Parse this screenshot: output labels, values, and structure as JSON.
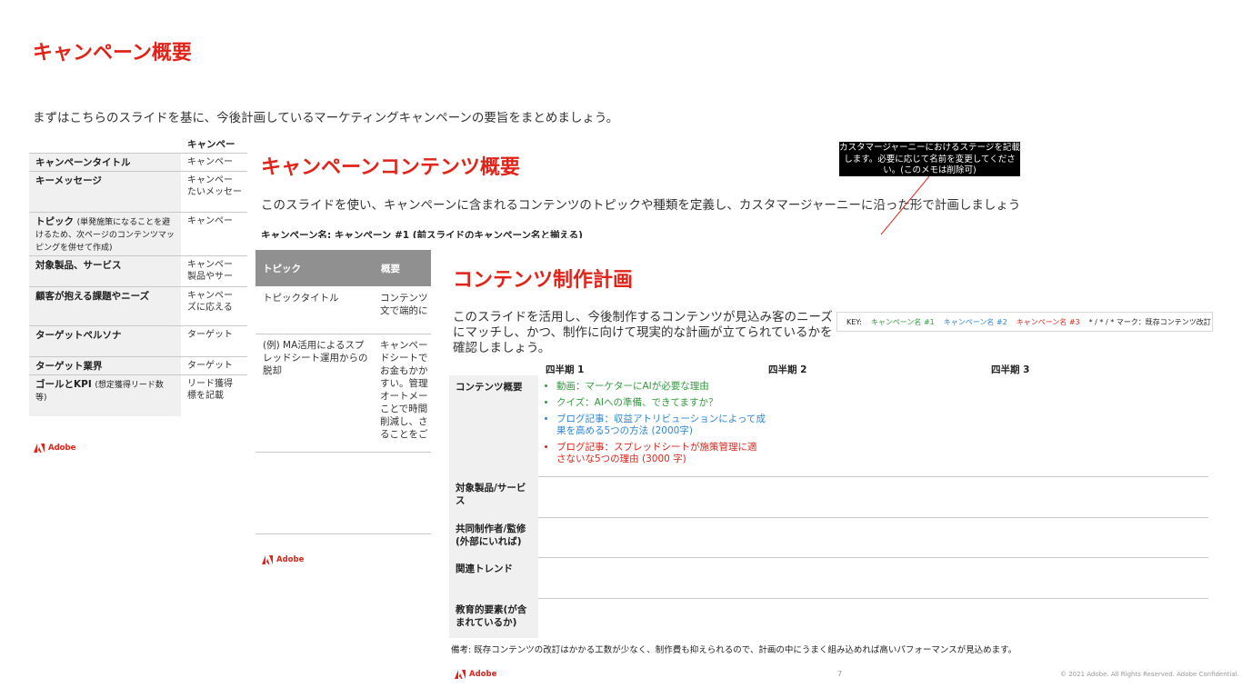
{
  "slide1": {
    "title": "キャンペーン概要",
    "intro": "まずはこちらのスライドを基に、今後計画しているマーケティングキャンペーンの要旨をまとめましょう。",
    "column_header": "キャンペー",
    "rows": [
      {
        "label": "キャンペーンタイトル",
        "note": "",
        "value": "キャンペー"
      },
      {
        "label": "キーメッセージ",
        "note": "",
        "value": "キャンペー\nたいメッセー"
      },
      {
        "label": "トピック",
        "note": "(単発施策になることを避けるため、次ページのコンテンツマッピングを併せて作成)",
        "value": "キャンペー"
      },
      {
        "label": "対象製品、サービス",
        "note": "",
        "value": "キャンペー\n製品やサー"
      },
      {
        "label": "顧客が抱える課題やニーズ",
        "note": "",
        "value": "キャンペー\nズに応える"
      },
      {
        "label": "ターゲットペルソナ",
        "note": "",
        "value": "ターゲット"
      },
      {
        "label": "ターゲット業界",
        "note": "",
        "value": "ターゲット"
      },
      {
        "label": "ゴールとKPI",
        "note": "(想定獲得リード数等)",
        "value": "リード獲得\n標を記載"
      }
    ],
    "logo": "Adobe"
  },
  "slide2": {
    "title": "キャンペーンコンテンツ概要",
    "intro": "このスライドを使い、キャンペーンに含まれるコンテンツのトピックや種類を定義し、カスタマージャーニーに沿った形で計画しましょう",
    "campaign_name": "キャンペーン名: キャンペーン #1 (前スライドのキャンペーン名と揃える)",
    "headers": [
      "トピック",
      "概要"
    ],
    "rows": [
      {
        "topic": "トピックタイトル",
        "desc": "コンテンツ\n文で端的に"
      },
      {
        "topic": "(例) MA活用によるスプレッドシート運用からの脱却",
        "desc": "キャンペー\nドシートで\nお金もかか\nすい。管理\nオートメー\nことで時間\n削減し、さ\nることをご"
      }
    ],
    "logo": "Adobe"
  },
  "callout": {
    "text": "カスタマージャーニーにおけるステージを記載します。必要に応じて名前を変更してください。(このメモは削除可)"
  },
  "slide3": {
    "title": "コンテンツ制作計画",
    "intro": "このスライドを活用し、今後制作するコンテンツが見込み客のニーズにマッチし、かつ、制作に向けて現実的な計画が立てられているかを確認しましょう。",
    "key": {
      "label": "KEY:",
      "items": [
        {
          "text": "キャンペーン名 #1",
          "color": "#2e9b3a"
        },
        {
          "text": "キャンペーン名 #2",
          "color": "#2f86d6"
        },
        {
          "text": "キャンペーン名 #3",
          "color": "#e2231a"
        },
        {
          "text": "* / * / * マーク：既存コンテンツ改訂",
          "color": "#222222"
        }
      ]
    },
    "quarters": [
      "四半期 1",
      "四半期 2",
      "四半期 3"
    ],
    "row_labels": [
      "コンテンツ概要",
      "対象製品/サービス",
      "共同制作者/監修(外部にいれば)",
      "関連トレンド",
      "教育的要素(が含まれているか)"
    ],
    "content_items": [
      {
        "text": "動画：マーケターにAIが必要な理由",
        "color": "#2e9b3a"
      },
      {
        "text": "クイズ：AIへの準備、できてますか？",
        "color": "#2e9b3a"
      },
      {
        "text": "ブログ記事：収益アトリビューションによって成果を高める5つの方法 (2000字)",
        "color": "#2f86d6"
      },
      {
        "text": "ブログ記事：スプレッドシートが施策管理に適さないな5つの理由 (3000 字)",
        "color": "#e2231a"
      }
    ],
    "note": "備考: 既存コンテンツの改訂はかかる工数が少なく、制作費も抑えられるので、計画の中にうまく組み込めれば高いパフォーマンスが見込めます。",
    "page_number": "7",
    "copyright": "© 2021 Adobe. All Rights Reserved. Adobe Confidential.",
    "logo": "Adobe"
  },
  "colors": {
    "accent": "#e2231a",
    "header_gray": "#909090",
    "label_bg": "#f0f0f0"
  }
}
